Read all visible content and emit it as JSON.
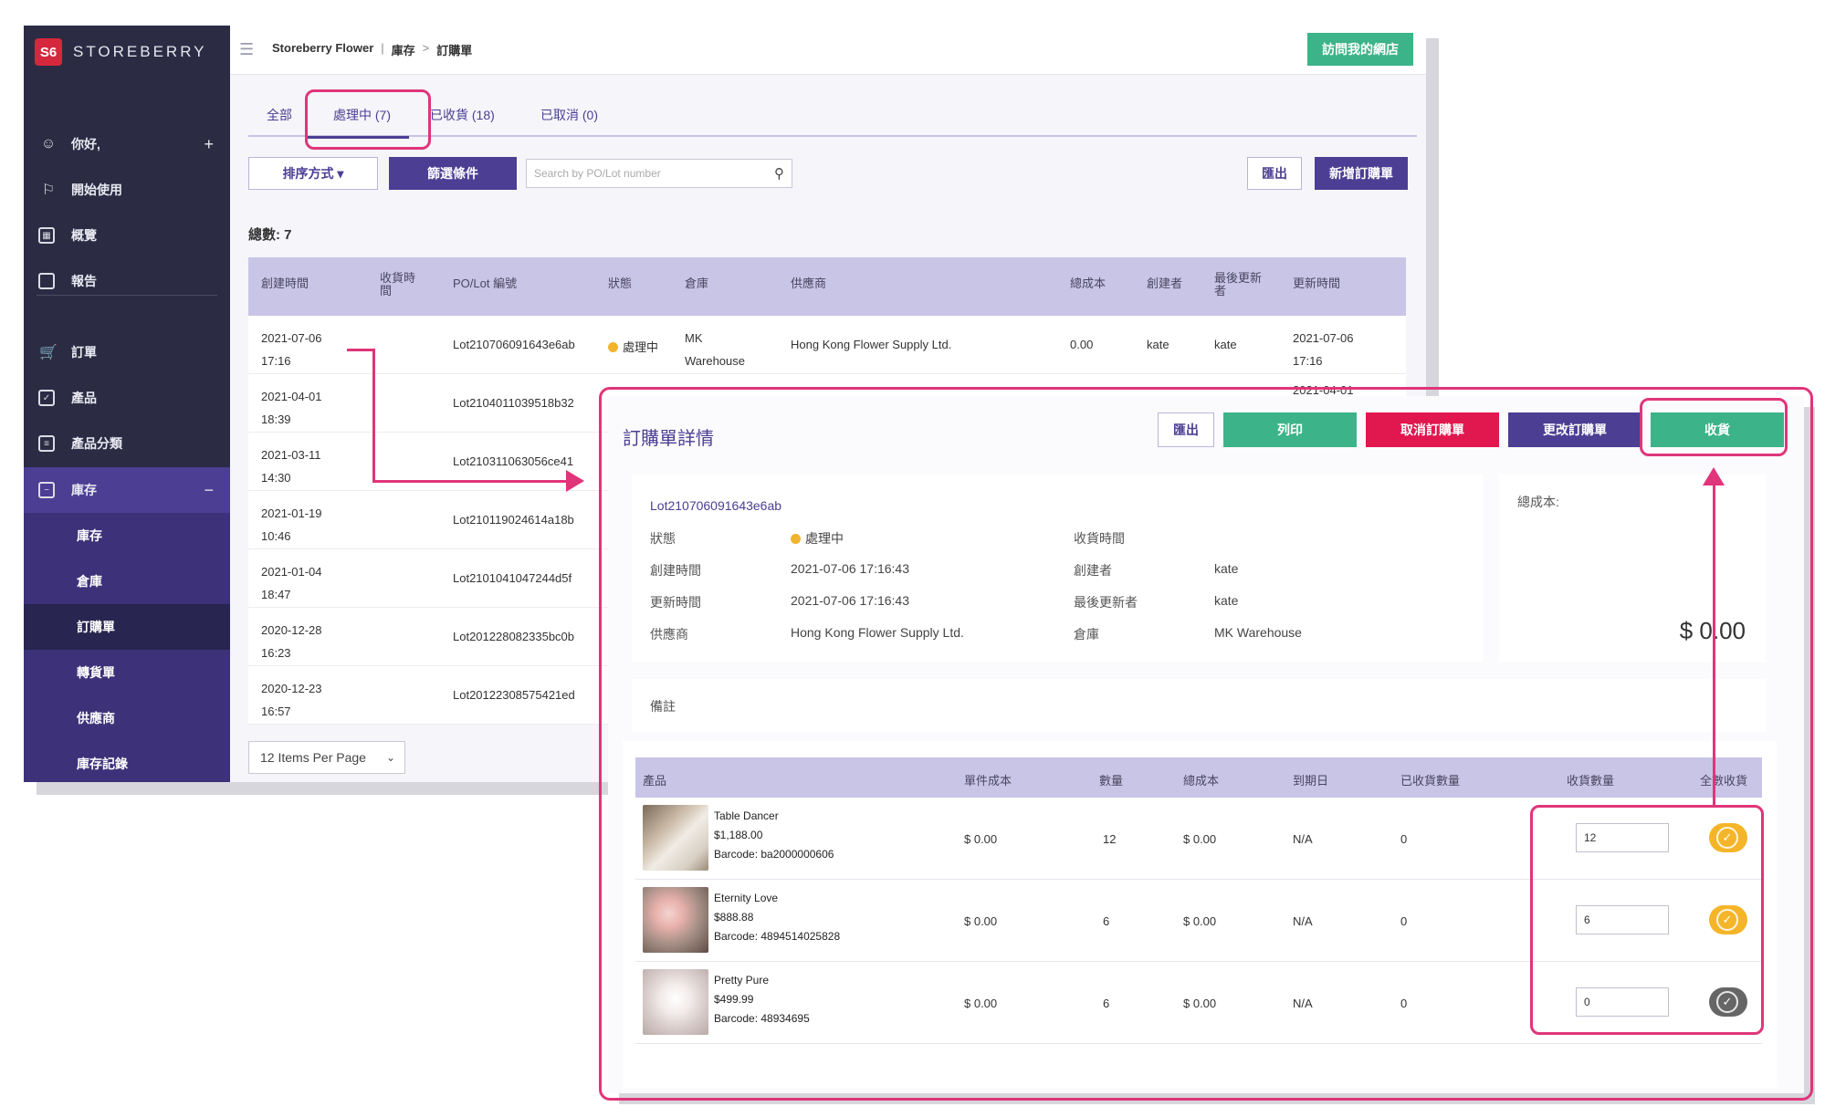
{
  "sidebar": {
    "brand": "STOREBERRY",
    "logo_text": "S6",
    "items": [
      {
        "label": "你好,",
        "icon": "person-icon",
        "trail": "+"
      },
      {
        "label": "開始使用",
        "icon": "flag-icon"
      },
      {
        "label": "概覽",
        "icon": "chart-icon"
      },
      {
        "label": "報告",
        "icon": "file-icon"
      },
      {
        "label": "訂單",
        "icon": "cart-icon"
      },
      {
        "label": "產品",
        "icon": "box-icon"
      },
      {
        "label": "產品分類",
        "icon": "list-icon"
      },
      {
        "label": "庫存",
        "icon": "inventory-icon",
        "trail": "−"
      }
    ],
    "subitems": [
      "庫存",
      "倉庫",
      "訂購單",
      "轉貨單",
      "供應商",
      "庫存記錄"
    ]
  },
  "topbar": {
    "breadcrumb": [
      "Storeberry Flower",
      "庫存",
      "訂購單"
    ],
    "visit_store": "訪問我的網店"
  },
  "tabs": [
    "全部",
    "處理中 (7)",
    "已收貨 (18)",
    "已取消 (0)"
  ],
  "toolbar": {
    "sort": "排序方式 ▾",
    "filter": "篩選條件",
    "search_placeholder": "Search by PO/Lot number",
    "export": "匯出",
    "new_po": "新增訂購單"
  },
  "total_label": "總數: 7",
  "list": {
    "columns": [
      "創建時間",
      "收貨時間",
      "PO/Lot 編號",
      "狀態",
      "倉庫",
      "供應商",
      "總成本",
      "創建者",
      "最後更新者",
      "更新時間"
    ],
    "first_row": {
      "status": "處理中",
      "warehouse": "MK\nWarehouse",
      "supplier": "Hong Kong Flower Supply Ltd.",
      "cost": "0.00",
      "creator": "kate",
      "updater": "kate",
      "updated": "2021-07-06\n17:16"
    },
    "second_row_updated": "2021-04-01",
    "rows": [
      {
        "created": "2021-07-06\n17:16",
        "lot": "Lot210706091643e6ab"
      },
      {
        "created": "2021-04-01\n18:39",
        "lot": "Lot2104011039518b32"
      },
      {
        "created": "2021-03-11\n14:30",
        "lot": "Lot210311063056ce41"
      },
      {
        "created": "2021-01-19\n10:46",
        "lot": "Lot210119024614a18b"
      },
      {
        "created": "2021-01-04\n18:47",
        "lot": "Lot2101041047244d5f"
      },
      {
        "created": "2020-12-28\n16:23",
        "lot": "Lot201228082335bc0b"
      },
      {
        "created": "2020-12-23\n16:57",
        "lot": "Lot20122308575421ed"
      }
    ],
    "per_page": "12 Items Per Page"
  },
  "detail": {
    "title": "訂購單詳情",
    "buttons": {
      "export": "匯出",
      "print": "列印",
      "cancel": "取消訂購單",
      "edit": "更改訂購單",
      "receive": "收貨"
    },
    "lot": "Lot210706091643e6ab",
    "fields": {
      "status_label": "狀態",
      "status_value": "處理中",
      "created_label": "創建時間",
      "created_value": "2021-07-06 17:16:43",
      "updated_label": "更新時間",
      "updated_value": "2021-07-06 17:16:43",
      "supplier_label": "供應商",
      "supplier_value": "Hong Kong Flower Supply Ltd.",
      "received_label": "收貨時間",
      "received_value": "",
      "creator_label": "創建者",
      "creator_value": "kate",
      "updater_label": "最後更新者",
      "updater_value": "kate",
      "warehouse_label": "倉庫",
      "warehouse_value": "MK Warehouse"
    },
    "total_cost_label": "總成本:",
    "total_cost_value": "$ 0.00",
    "memo_label": "備註",
    "product_columns": [
      "產品",
      "單件成本",
      "數量",
      "總成本",
      "到期日",
      "已收貨數量",
      "收貨數量",
      "全數收貨"
    ],
    "products": [
      {
        "name": "Table Dancer",
        "price": "$1,188.00",
        "barcode": "Barcode: ba2000000606",
        "unit_cost": "$ 0.00",
        "qty": "12",
        "total": "$ 0.00",
        "expiry": "N/A",
        "received": "0",
        "receive_qty": "12",
        "all_received": true
      },
      {
        "name": "Eternity Love",
        "price": "$888.88",
        "barcode": "Barcode: 4894514025828",
        "unit_cost": "$ 0.00",
        "qty": "6",
        "total": "$ 0.00",
        "expiry": "N/A",
        "received": "0",
        "receive_qty": "6",
        "all_received": true
      },
      {
        "name": "Pretty Pure",
        "price": "$499.99",
        "barcode": "Barcode: 48934695",
        "unit_cost": "$ 0.00",
        "qty": "6",
        "total": "$ 0.00",
        "expiry": "N/A",
        "received": "0",
        "receive_qty": "0",
        "all_received": false
      }
    ]
  },
  "colors": {
    "sidebar_bg": "#2b2c43",
    "brand_purple": "#4b3e93",
    "green": "#3db389",
    "red": "#e1174f",
    "highlight_pink": "#e0357a",
    "toggle_on": "#f5b529"
  }
}
